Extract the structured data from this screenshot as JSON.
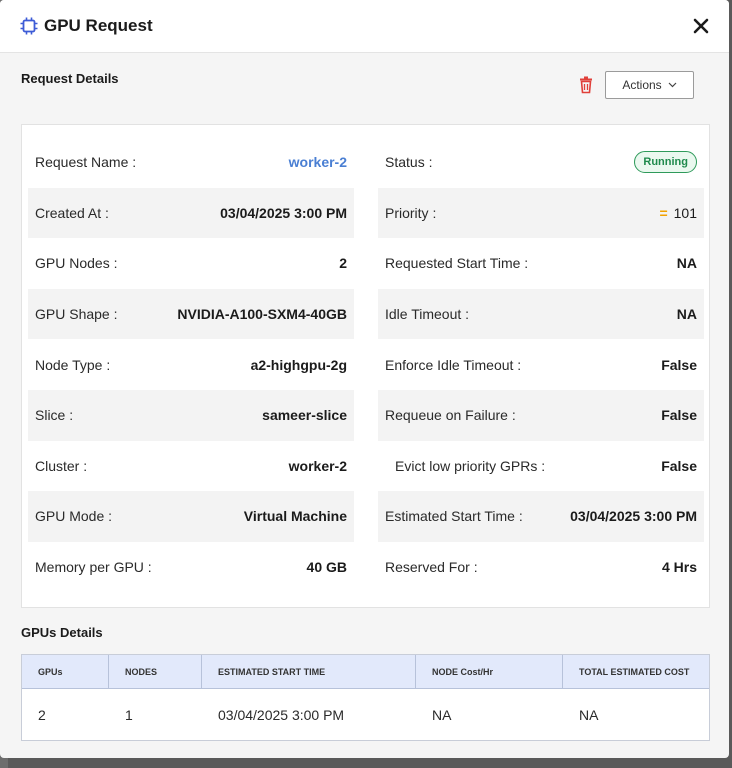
{
  "modal": {
    "title": "GPU Request",
    "close_label": "✕"
  },
  "request_details": {
    "title": "Request Details",
    "actions_label": "Actions",
    "left": [
      {
        "label": "Request Name :",
        "value": "worker-2"
      },
      {
        "label": "Created At :",
        "value": "03/04/2025 3:00 PM"
      },
      {
        "label": "GPU Nodes :",
        "value": "2"
      },
      {
        "label": "GPU Shape :",
        "value": "NVIDIA-A100-SXM4-40GB"
      },
      {
        "label": "Node Type :",
        "value": "a2-highgpu-2g"
      },
      {
        "label": "Slice :",
        "value": "sameer-slice"
      },
      {
        "label": "Cluster :",
        "value": "worker-2"
      },
      {
        "label": "GPU Mode :",
        "value": "Virtual Machine"
      },
      {
        "label": "Memory per GPU :",
        "value": "40 GB"
      }
    ],
    "right": [
      {
        "label": "Status :",
        "value": "Running"
      },
      {
        "label": "Priority :",
        "value": "101",
        "icon": "="
      },
      {
        "label": "Requested Start Time :",
        "value": "NA"
      },
      {
        "label": "Idle Timeout :",
        "value": "NA"
      },
      {
        "label": "Enforce Idle Timeout :",
        "value": "False"
      },
      {
        "label": "Requeue on Failure :",
        "value": "False"
      },
      {
        "label": "Evict low priority GPRs :",
        "value": "False"
      },
      {
        "label": "Estimated Start Time :",
        "value": "03/04/2025 3:00 PM"
      },
      {
        "label": "Reserved For :",
        "value": "4 Hrs"
      }
    ]
  },
  "gpus_details": {
    "title": "GPUs Details",
    "columns": [
      "GPUs",
      "NODES",
      "ESTIMATED START TIME",
      "NODE Cost/Hr",
      "TOTAL ESTIMATED COST"
    ],
    "rows": [
      [
        "2",
        "1",
        "03/04/2025 3:00 PM",
        "NA",
        "NA"
      ]
    ]
  },
  "colors": {
    "link": "#4a7fd3",
    "status_green": "#1f8a4c",
    "priority_icon": "#f2a200",
    "delete_red": "#e0403a",
    "table_header_bg": "#e2e9fb",
    "chip_icon_blue": "#3c5bd6"
  }
}
